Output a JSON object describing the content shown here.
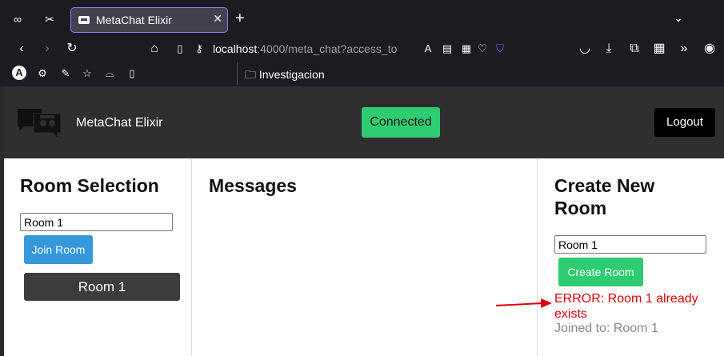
{
  "browser": {
    "tab": {
      "title": "MetaChat Elixir",
      "close": "✕"
    },
    "new_tab": "+",
    "tab_list": "⌄",
    "url": {
      "host": "localhost",
      "rest": ":4000/meta_chat?access_to"
    },
    "bookmark_folder": "Investigacion",
    "profile_letter": "A",
    "theme": {
      "accent": "#8f7bff",
      "chrome_bg": "#1c1b22",
      "tab_bg": "#42414d"
    }
  },
  "app": {
    "title": "MetaChat Elixir",
    "status": "Connected",
    "logout": "Logout",
    "colors": {
      "header": "#2f2f2f",
      "success": "#2ecc71",
      "primary": "#3498db",
      "room": "#3c3c3c",
      "error": "#e0000a"
    }
  },
  "room_selection": {
    "heading": "Room Selection",
    "input_value": "Room 1",
    "join_label": "Join Room",
    "rooms": [
      "Room 1"
    ]
  },
  "messages": {
    "heading": "Messages"
  },
  "create_room": {
    "heading_line1": "Create New",
    "heading_line2": "Room",
    "input_value": "Room 1",
    "create_label": "Create Room",
    "error": "ERROR: Room 1 already exists",
    "joined": "Joined to: Room 1"
  }
}
